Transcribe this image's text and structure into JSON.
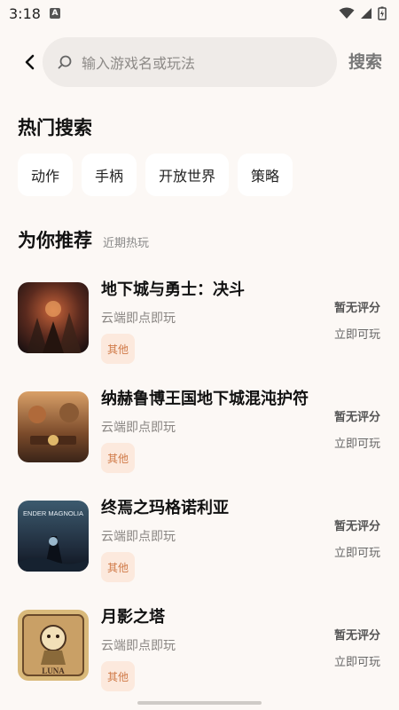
{
  "status_bar": {
    "time": "3:18",
    "app_icon_letter": "A"
  },
  "search": {
    "placeholder": "输入游戏名或玩法",
    "button_label": "搜索"
  },
  "hot_search": {
    "title": "热门搜索",
    "chips": [
      "动作",
      "手柄",
      "开放世界",
      "策略"
    ]
  },
  "recommend": {
    "title": "为你推荐",
    "subtitle": "近期热玩",
    "games": [
      {
        "name": "地下城与勇士：决斗",
        "desc": "云端即点即玩",
        "tag": "其他",
        "rating": "暂无评分",
        "play": "立即可玩",
        "cover_colors": [
          "#5a2a1e",
          "#b8552e",
          "#2a1a1a"
        ]
      },
      {
        "name": "纳赫鲁博王国地下城混沌护符",
        "desc": "云端即点即玩",
        "tag": "其他",
        "rating": "暂无评分",
        "play": "立即可玩",
        "cover_colors": [
          "#7a4a2a",
          "#c9864a",
          "#3a2418"
        ]
      },
      {
        "name": "终焉之玛格诺利亚",
        "desc": "云端即点即玩",
        "tag": "其他",
        "rating": "暂无评分",
        "play": "立即可玩",
        "cover_colors": [
          "#1e2a3a",
          "#3c5a6e",
          "#0e141e"
        ]
      },
      {
        "name": "月影之塔",
        "desc": "云端即点即玩",
        "tag": "其他",
        "rating": "暂无评分",
        "play": "立即可玩",
        "cover_colors": [
          "#d9b97a",
          "#8a6a3a",
          "#4a3220"
        ]
      }
    ]
  },
  "cover_texts": [
    "ENDER MAGNOLIA",
    "LUNA"
  ]
}
